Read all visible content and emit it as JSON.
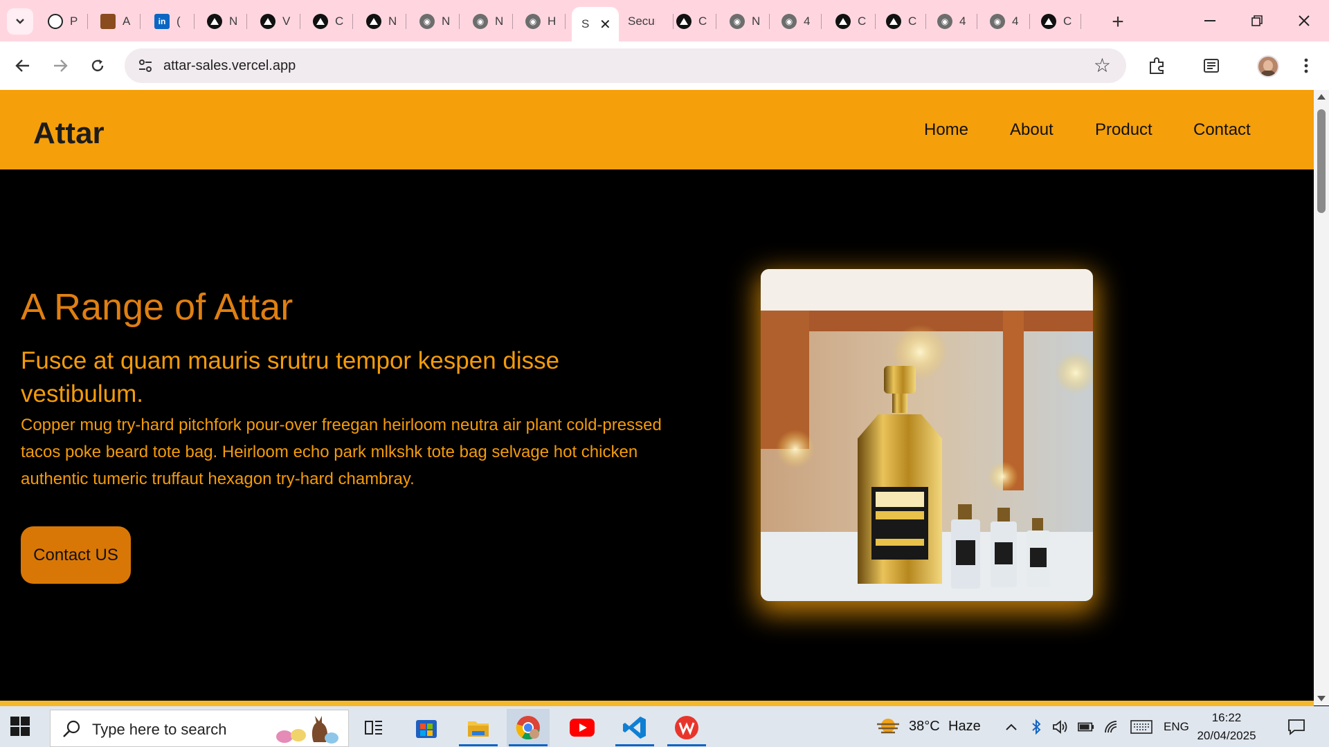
{
  "browser": {
    "tabs": [
      {
        "label": "P",
        "favicon": "openai-icon"
      },
      {
        "label": "A",
        "favicon": "briefcase-icon"
      },
      {
        "label": "(",
        "favicon": "linkedin-icon"
      },
      {
        "label": "N",
        "favicon": "vercel-icon"
      },
      {
        "label": "V",
        "favicon": "vercel-icon"
      },
      {
        "label": "C",
        "favicon": "vercel-icon"
      },
      {
        "label": "N",
        "favicon": "vercel-icon"
      },
      {
        "label": "N",
        "favicon": "globe-icon"
      },
      {
        "label": "N",
        "favicon": "globe-icon"
      },
      {
        "label": "H",
        "favicon": "globe-icon"
      },
      {
        "label": "S",
        "favicon": "none",
        "active": true
      },
      {
        "label": "Secur",
        "favicon": "none"
      },
      {
        "label": "C",
        "favicon": "vercel-icon"
      },
      {
        "label": "N",
        "favicon": "globe-icon"
      },
      {
        "label": "4",
        "favicon": "globe-icon"
      },
      {
        "label": "C",
        "favicon": "vercel-icon"
      },
      {
        "label": "C",
        "favicon": "vercel-icon"
      },
      {
        "label": "4",
        "favicon": "globe-icon"
      },
      {
        "label": "4",
        "favicon": "globe-icon"
      },
      {
        "label": "C",
        "favicon": "vercel-icon"
      }
    ],
    "url": "attar-sales.vercel.app"
  },
  "site": {
    "brand": "Attar",
    "nav": {
      "home": "Home",
      "about": "About",
      "product": "Product",
      "contact": "Contact"
    },
    "hero": {
      "title": "A Range of Attar",
      "subtitle": "Fusce at quam mauris srutru tempor kespen disse vestibulum.",
      "body": "Copper mug try-hard pitchfork pour-over freegan heirloom neutra air plant cold-pressed tacos poke beard tote bag. Heirloom echo park mlkshk tote bag selvage hot chicken authentic tumeric truffaut hexagon try-hard chambray.",
      "cta": "Contact US"
    },
    "colors": {
      "navbar": "#f59f0b",
      "accent": "#df7f12",
      "text_accent": "#f49b0b",
      "button": "#d97706",
      "background": "#000000"
    }
  },
  "taskbar": {
    "search_placeholder": "Type here to search",
    "weather": {
      "temp": "38°C",
      "condition": "Haze"
    },
    "language": "ENG",
    "time": "16:22",
    "date": "20/04/2025"
  }
}
